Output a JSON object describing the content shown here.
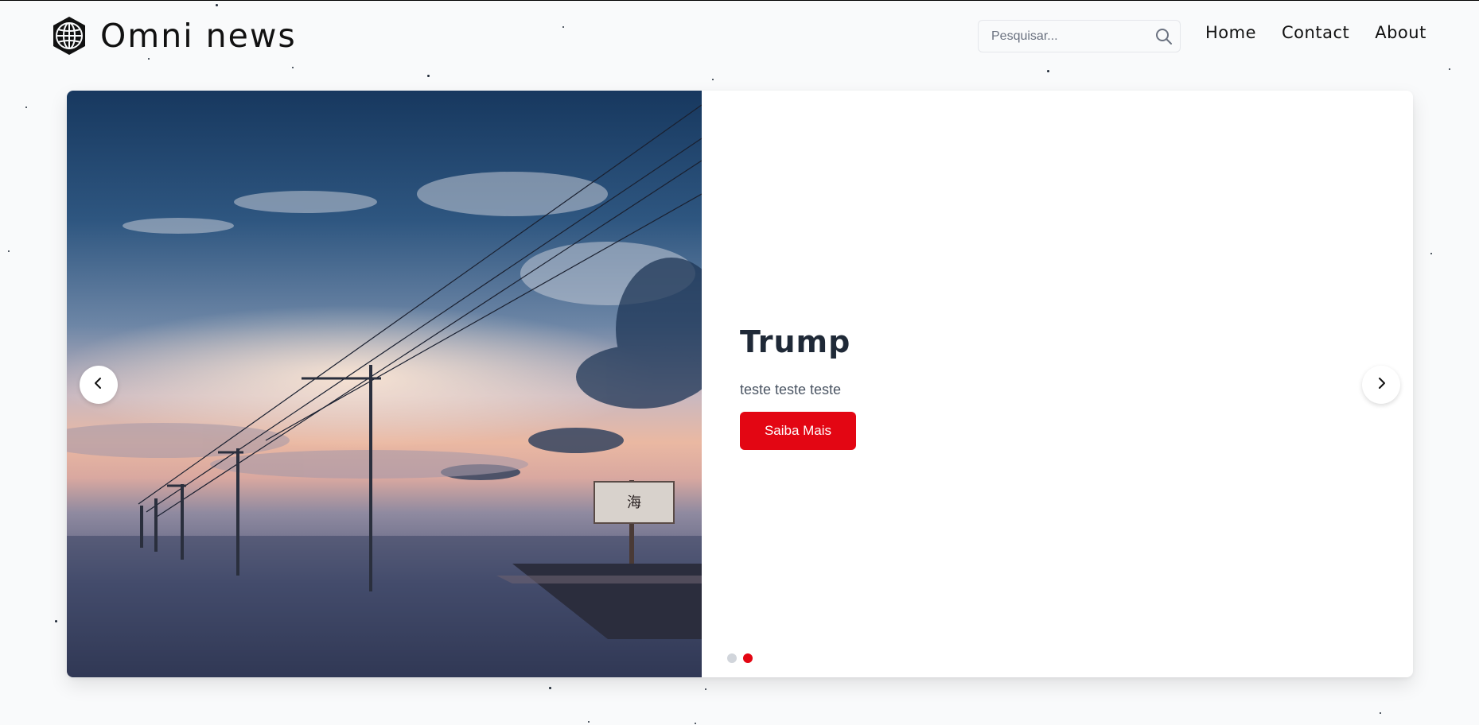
{
  "site": {
    "logo_text": "Omni news",
    "logo_icon": "globe-icon"
  },
  "search": {
    "placeholder": "Pesquisar...",
    "value": "",
    "icon": "search-icon"
  },
  "nav": {
    "items": [
      {
        "label": "Home"
      },
      {
        "label": "Contact"
      },
      {
        "label": "About"
      }
    ]
  },
  "carousel": {
    "slide": {
      "title": "Trump",
      "description": "teste teste teste",
      "button_label": "Saiba Mais"
    },
    "prev_icon": "chevron-left-icon",
    "next_icon": "chevron-right-icon",
    "indicators": [
      {
        "active": false
      },
      {
        "active": true
      }
    ]
  },
  "colors": {
    "accent": "#e30613",
    "background": "#f9fafb",
    "text_dark": "#1f2937",
    "indicator_inactive": "#d1d5db"
  }
}
